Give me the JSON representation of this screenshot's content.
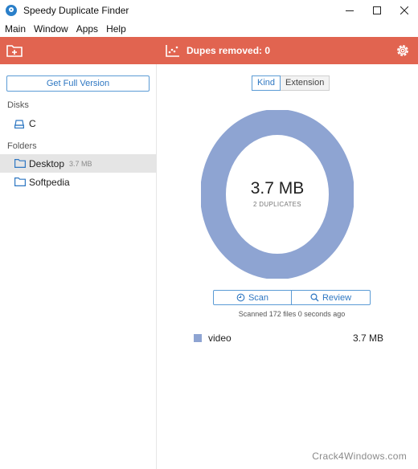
{
  "window": {
    "title": "Speedy Duplicate Finder"
  },
  "menu": [
    "Main",
    "Window",
    "Apps",
    "Help"
  ],
  "toolbar": {
    "status": "Dupes removed: 0"
  },
  "sidebar": {
    "get_full_version": "Get Full Version",
    "disks_label": "Disks",
    "disks": [
      {
        "name": "C"
      }
    ],
    "folders_label": "Folders",
    "folders": [
      {
        "name": "Desktop",
        "size": "3.7 MB",
        "selected": true
      },
      {
        "name": "Softpedia",
        "size": "",
        "selected": false
      }
    ]
  },
  "main": {
    "tabs": [
      {
        "label": "Kind",
        "active": true
      },
      {
        "label": "Extension",
        "active": false
      }
    ],
    "donut": {
      "value": "3.7 MB",
      "subtitle": "2 DUPLICATES",
      "color": "#8ea4d2"
    },
    "scan_label": "Scan",
    "review_label": "Review",
    "scan_status": "Scanned 172 files 0 seconds ago",
    "legend": [
      {
        "label": "video",
        "value": "3.7 MB",
        "color": "#8ea4d2"
      }
    ]
  },
  "watermark": "Crack4Windows.com",
  "colors": {
    "accent_bar": "#e16450",
    "link_blue": "#2e77c2"
  }
}
